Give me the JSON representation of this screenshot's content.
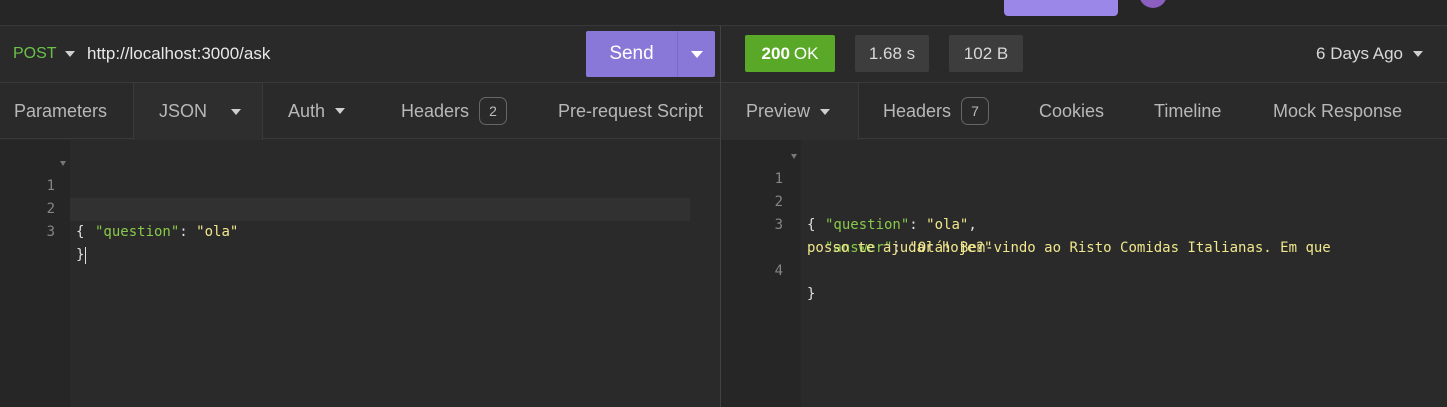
{
  "request": {
    "method": "POST",
    "url": "http://localhost:3000/ask",
    "send_label": "Send",
    "tabs": [
      {
        "label": "Parameters"
      },
      {
        "label": "JSON"
      },
      {
        "label": "Auth"
      },
      {
        "label": "Headers",
        "badge": "2"
      },
      {
        "label": "Pre-request Script"
      }
    ],
    "body_lines": [
      {
        "num": "1"
      },
      {
        "num": "2",
        "key": "\"question\"",
        "value": "\"ola\""
      },
      {
        "num": "3"
      }
    ],
    "open_brace": "{",
    "close_brace": "}",
    "colon": ": "
  },
  "response": {
    "status_code": "200",
    "status_text": "OK",
    "time": "1.68 s",
    "size": "102 B",
    "received": "6 Days Ago",
    "tabs": [
      {
        "label": "Preview"
      },
      {
        "label": "Headers",
        "badge": "7"
      },
      {
        "label": "Cookies"
      },
      {
        "label": "Timeline"
      },
      {
        "label": "Mock Response"
      }
    ],
    "body_lines": [
      {
        "num": "1"
      },
      {
        "num": "2",
        "key": "\"question\"",
        "value": "\"ola\""
      },
      {
        "num": "3",
        "key": "\"answer\"",
        "value": "\"Olá! Bem-vindo ao Risto Comidas Italianas. Em que",
        "value_cont": "posso te ajudar hoje?\""
      },
      {
        "num": "4"
      }
    ],
    "open_brace": "{",
    "close_brace": "}",
    "colon": ": ",
    "comma": ","
  },
  "colors": {
    "method": "#6cc04a",
    "send": "#8a78d8",
    "status_ok": "#5aa827",
    "json_key": "#88c94a",
    "json_string": "#f0e68c"
  }
}
